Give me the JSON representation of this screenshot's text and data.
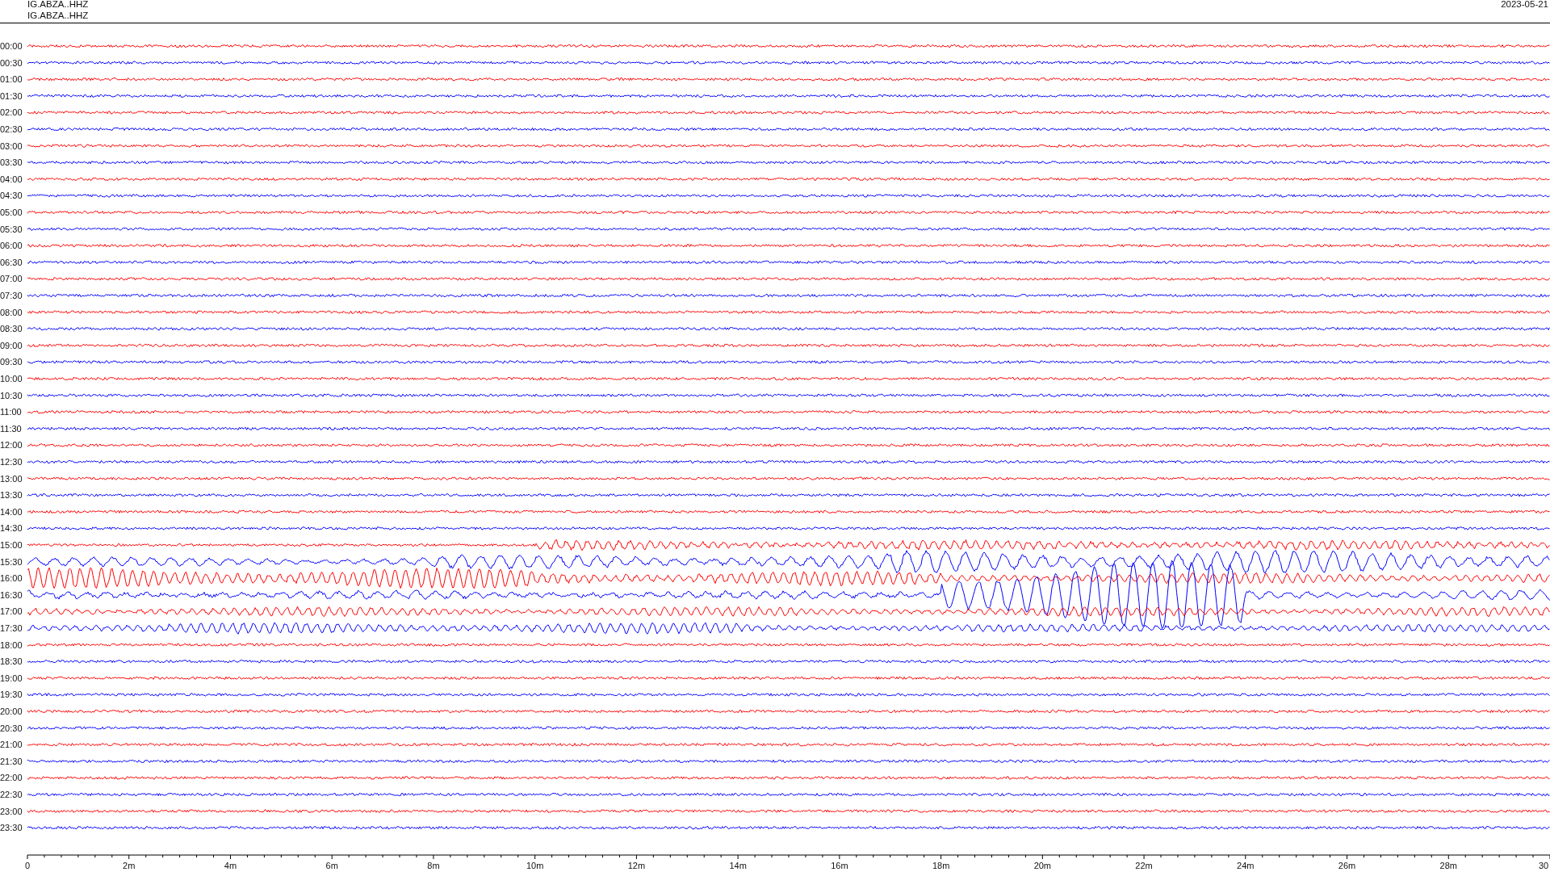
{
  "header": {
    "stations": [
      "IG.ABZA..HHZ",
      "IG.ABZA..HHZ"
    ],
    "date": "2023-05-21"
  },
  "traces": [
    {
      "time": "00:00",
      "color": "#ff0000"
    },
    {
      "time": "00:30",
      "color": "#0000ff"
    },
    {
      "time": "01:00",
      "color": "#ff0000"
    },
    {
      "time": "01:30",
      "color": "#0000ff"
    },
    {
      "time": "02:00",
      "color": "#ff0000"
    },
    {
      "time": "02:30",
      "color": "#0000ff"
    },
    {
      "time": "03:00",
      "color": "#ff0000"
    },
    {
      "time": "03:30",
      "color": "#0000ff"
    },
    {
      "time": "04:00",
      "color": "#ff0000"
    },
    {
      "time": "04:30",
      "color": "#0000ff"
    },
    {
      "time": "05:00",
      "color": "#ff0000"
    },
    {
      "time": "05:30",
      "color": "#0000ff"
    },
    {
      "time": "06:00",
      "color": "#ff0000"
    },
    {
      "time": "06:30",
      "color": "#0000ff"
    },
    {
      "time": "07:00",
      "color": "#ff0000"
    },
    {
      "time": "07:30",
      "color": "#0000ff"
    },
    {
      "time": "08:00",
      "color": "#ff0000"
    },
    {
      "time": "08:30",
      "color": "#0000ff"
    },
    {
      "time": "09:00",
      "color": "#ff0000"
    },
    {
      "time": "09:30",
      "color": "#0000ff"
    },
    {
      "time": "10:00",
      "color": "#ff0000"
    },
    {
      "time": "10:30",
      "color": "#0000ff"
    },
    {
      "time": "11:00",
      "color": "#ff0000"
    },
    {
      "time": "11:30",
      "color": "#0000ff"
    },
    {
      "time": "12:00",
      "color": "#ff0000"
    },
    {
      "time": "12:30",
      "color": "#0000ff"
    },
    {
      "time": "13:00",
      "color": "#ff0000"
    },
    {
      "time": "13:30",
      "color": "#0000ff"
    },
    {
      "time": "14:00",
      "color": "#ff0000"
    },
    {
      "time": "14:30",
      "color": "#0000ff"
    },
    {
      "time": "15:00",
      "color": "#ff0000"
    },
    {
      "time": "15:30",
      "color": "#0000ff"
    },
    {
      "time": "16:00",
      "color": "#ff0000"
    },
    {
      "time": "16:30",
      "color": "#0000ff"
    },
    {
      "time": "17:00",
      "color": "#ff0000"
    },
    {
      "time": "17:30",
      "color": "#0000ff"
    },
    {
      "time": "18:00",
      "color": "#ff0000"
    },
    {
      "time": "18:30",
      "color": "#0000ff"
    },
    {
      "time": "19:00",
      "color": "#ff0000"
    },
    {
      "time": "19:30",
      "color": "#0000ff"
    },
    {
      "time": "20:00",
      "color": "#ff0000"
    },
    {
      "time": "20:30",
      "color": "#0000ff"
    },
    {
      "time": "21:00",
      "color": "#ff0000"
    },
    {
      "time": "21:30",
      "color": "#0000ff"
    },
    {
      "time": "22:00",
      "color": "#ff0000"
    },
    {
      "time": "22:30",
      "color": "#0000ff"
    },
    {
      "time": "23:00",
      "color": "#ff0000"
    },
    {
      "time": "23:30",
      "color": "#0000ff"
    }
  ],
  "axis": {
    "ticks": [
      "0",
      "2m",
      "4m",
      "6m",
      "8m",
      "10m",
      "12m",
      "14m",
      "16m",
      "18m",
      "20m",
      "22m",
      "24m",
      "26m",
      "28m",
      "30"
    ]
  }
}
